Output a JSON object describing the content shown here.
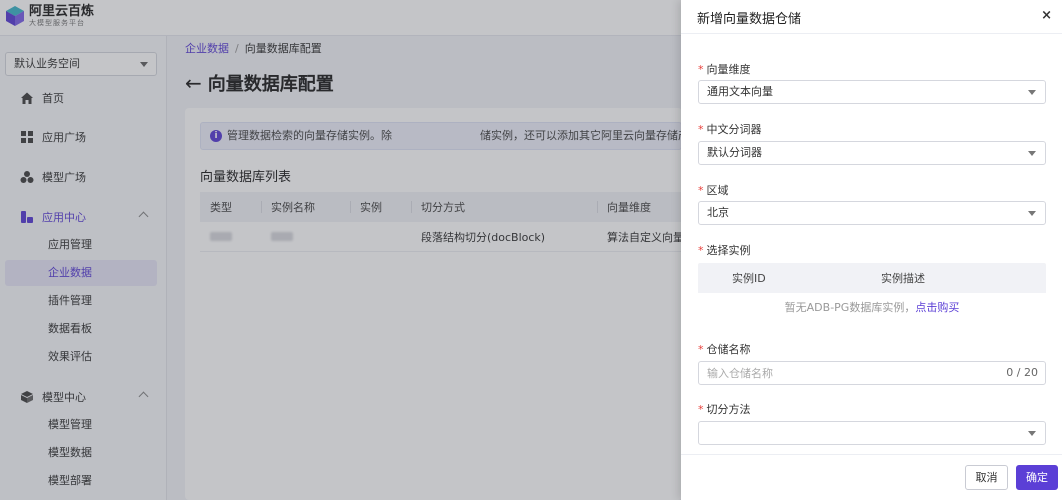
{
  "brand": {
    "name": "阿里云百炼",
    "subtitle": "大模型服务平台"
  },
  "sidebar": {
    "workspace": "默认业务空间",
    "items": [
      {
        "label": "首页",
        "icon": "home-icon"
      },
      {
        "label": "应用广场",
        "icon": "grid-icon"
      },
      {
        "label": "模型广场",
        "icon": "cluster-icon"
      },
      {
        "label": "应用中心",
        "icon": "app-center-icon",
        "expanded": true,
        "children": [
          "应用管理",
          "企业数据",
          "插件管理",
          "数据看板",
          "效果评估"
        ],
        "active_child": "企业数据"
      },
      {
        "label": "模型中心",
        "icon": "model-center-icon",
        "expanded": true,
        "children": [
          "模型管理",
          "模型数据",
          "模型部署"
        ]
      }
    ]
  },
  "breadcrumb": {
    "parent": "企业数据",
    "separator": "/",
    "current": "向量数据库配置"
  },
  "page": {
    "back_icon": "←",
    "title": "向量数据库配置",
    "notice": "管理数据检索的向量存储实例。除        储实例，还可以添加其它阿里云向量存储产品的实例，以",
    "section_title": "向量数据库列表",
    "table": {
      "columns": [
        "类型",
        "实例名称",
        "实例",
        "切分方式",
        "向量维度"
      ],
      "rows": [
        {
          "split": "段落结构切分(docBlock)",
          "dim": "算法自定义向量("
        }
      ]
    }
  },
  "drawer": {
    "title": "新增向量数据仓储",
    "close_icon": "×",
    "fields": {
      "dimension": {
        "label": "向量维度",
        "value": "通用文本向量"
      },
      "tokenizer": {
        "label": "中文分词器",
        "value": "默认分词器"
      },
      "region": {
        "label": "区域",
        "value": "北京"
      },
      "instance": {
        "label": "选择实例",
        "columns": [
          "实例ID",
          "实例描述"
        ],
        "empty_text": "暂无ADB-PG数据库实例，",
        "empty_link": "点击购买"
      },
      "store_name": {
        "label": "仓储名称",
        "placeholder": "输入仓储名称",
        "counter": "0 / 20"
      },
      "split_method": {
        "label": "切分方法",
        "value": ""
      }
    },
    "required_mark": "*",
    "cancel_label": "取消",
    "ok_label": "确定"
  },
  "colors": {
    "accent": "#5b3fd6",
    "required": "#e8413b"
  }
}
